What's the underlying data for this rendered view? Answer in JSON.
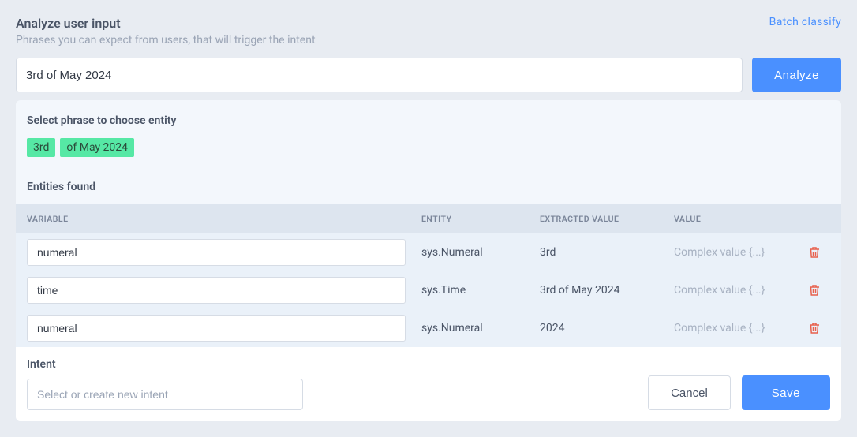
{
  "header": {
    "title": "Analyze user input",
    "subtitle": "Phrases you can expect from users, that will trigger the intent",
    "batch_link": "Batch classify"
  },
  "input": {
    "value": "3rd of May 2024",
    "analyze_label": "Analyze"
  },
  "phrase_section": {
    "label": "Select phrase to choose entity",
    "chips": [
      "3rd",
      "of  May  2024"
    ]
  },
  "entities_label": "Entities found",
  "table": {
    "headers": {
      "variable": "VARIABLE",
      "entity": "ENTITY",
      "extracted": "EXTRACTED VALUE",
      "value": "VALUE"
    },
    "rows": [
      {
        "variable": "numeral",
        "entity": "sys.Numeral",
        "extracted": "3rd",
        "value": "Complex value {...}"
      },
      {
        "variable": "time",
        "entity": "sys.Time",
        "extracted": "3rd of May 2024",
        "value": "Complex value {...}"
      },
      {
        "variable": "numeral",
        "entity": "sys.Numeral",
        "extracted": "2024",
        "value": "Complex value {...}"
      }
    ]
  },
  "intent": {
    "label": "Intent",
    "placeholder": "Select or create new intent"
  },
  "footer": {
    "cancel": "Cancel",
    "save": "Save"
  }
}
